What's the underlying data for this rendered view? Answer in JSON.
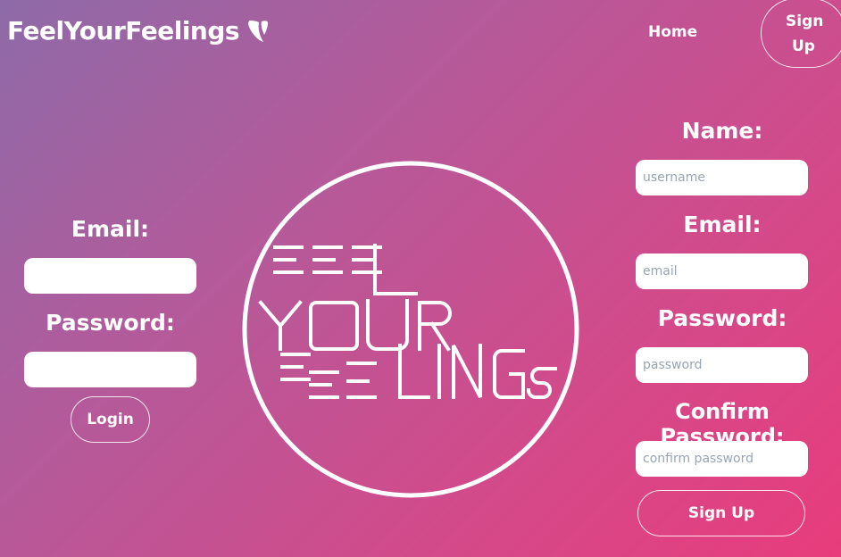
{
  "header": {
    "brand": "FeelYourFeelings",
    "nav_home": "Home",
    "nav_signup": "Sign Up"
  },
  "login": {
    "email_label": "Email:",
    "password_label": "Password:",
    "email_placeholder": "",
    "password_placeholder": "",
    "submit_label": "Login"
  },
  "center_logo": {
    "lines": [
      "FEEL",
      "YOUR",
      "FEELINGS"
    ]
  },
  "signup": {
    "name_label": "Name:",
    "name_placeholder": "username",
    "email_label": "Email:",
    "email_placeholder": "email",
    "password_label": "Password:",
    "password_placeholder": "password",
    "confirm_label": "Confirm Password:",
    "confirm_placeholder": "confirm password",
    "submit_label": "Sign Up"
  },
  "colors": {
    "gradient_start": "#8e6aa8",
    "gradient_end": "#e83c7c",
    "text": "#ffffff"
  }
}
